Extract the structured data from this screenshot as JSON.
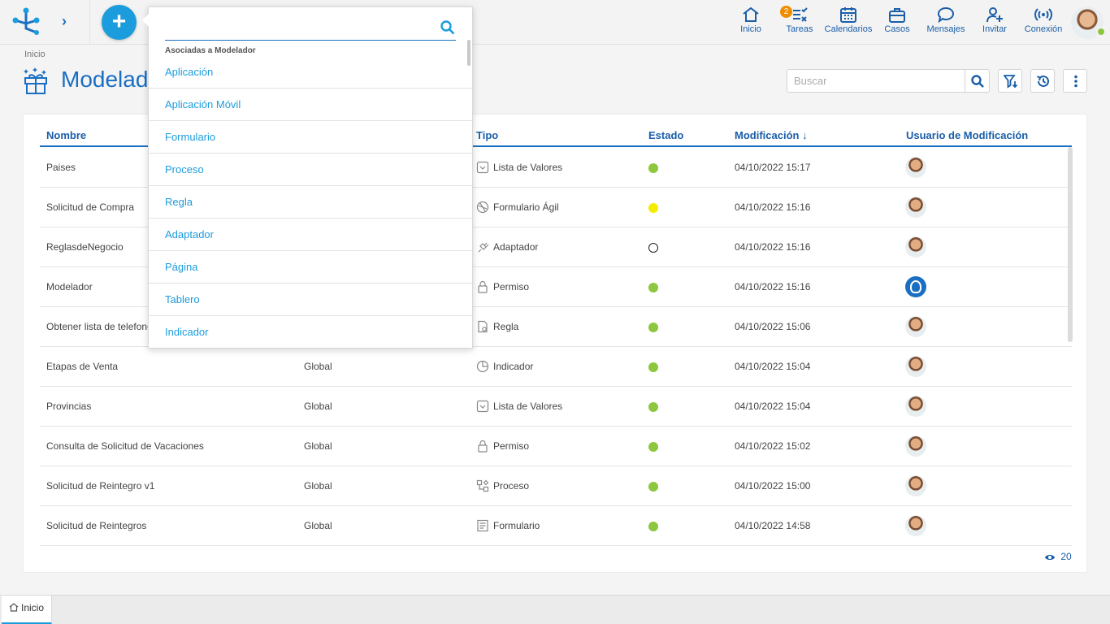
{
  "topbar": {
    "nav": [
      {
        "label": "Inicio",
        "icon": "home-icon"
      },
      {
        "label": "Tareas",
        "icon": "tasks-icon",
        "badge": "2"
      },
      {
        "label": "Calendarios",
        "icon": "calendar-icon"
      },
      {
        "label": "Casos",
        "icon": "briefcase-icon"
      },
      {
        "label": "Mensajes",
        "icon": "chat-icon"
      },
      {
        "label": "Invitar",
        "icon": "invite-user-icon"
      },
      {
        "label": "Conexión",
        "icon": "connection-icon"
      }
    ]
  },
  "breadcrumb": "Inicio",
  "page": {
    "title": "Modelador"
  },
  "search": {
    "placeholder": "Buscar"
  },
  "table": {
    "headers": {
      "nombre": "Nombre",
      "tipo": "Tipo",
      "estado": "Estado",
      "modificacion": "Modificación",
      "usuario": "Usuario de Modificación"
    },
    "rows": [
      {
        "nombre": "Paises",
        "ambito": "",
        "tipo": "Lista de Valores",
        "estado": "#8dc63f",
        "fecha": "04/10/2022 15:17",
        "usuario": "user-photo"
      },
      {
        "nombre": "Solicitud de Compra",
        "ambito": "",
        "tipo": "Formulario Ágil",
        "estado": "#f5ec00",
        "fecha": "04/10/2022 15:16",
        "usuario": "user-photo"
      },
      {
        "nombre": "ReglasdeNegocio",
        "ambito": "",
        "tipo": "Adaptador",
        "estado": "#ffffff",
        "fecha": "04/10/2022 15:16",
        "usuario": "user-photo"
      },
      {
        "nombre": "Modelador",
        "ambito": "",
        "tipo": "Permiso",
        "estado": "#8dc63f",
        "fecha": "04/10/2022 15:16",
        "usuario": "system-user"
      },
      {
        "nombre": "Obtener lista de telefonos",
        "ambito": "",
        "tipo": "Regla",
        "estado": "#8dc63f",
        "fecha": "04/10/2022 15:06",
        "usuario": "user-photo"
      },
      {
        "nombre": "Etapas de Venta",
        "ambito": "Global",
        "tipo": "Indicador",
        "estado": "#8dc63f",
        "fecha": "04/10/2022 15:04",
        "usuario": "user-photo"
      },
      {
        "nombre": "Provincias",
        "ambito": "Global",
        "tipo": "Lista de Valores",
        "estado": "#8dc63f",
        "fecha": "04/10/2022 15:04",
        "usuario": "user-photo"
      },
      {
        "nombre": "Consulta de Solicitud de Vacaciones",
        "ambito": "Global",
        "tipo": "Permiso",
        "estado": "#8dc63f",
        "fecha": "04/10/2022 15:02",
        "usuario": "user-photo"
      },
      {
        "nombre": "Solicitud de Reintegro v1",
        "ambito": "Global",
        "tipo": "Proceso",
        "estado": "#8dc63f",
        "fecha": "04/10/2022 15:00",
        "usuario": "user-photo"
      },
      {
        "nombre": "Solicitud de Reintegros",
        "ambito": "Global",
        "tipo": "Formulario",
        "estado": "#8dc63f",
        "fecha": "04/10/2022 14:58",
        "usuario": "user-photo"
      }
    ],
    "views_count": "20"
  },
  "dropdown": {
    "search_value": "",
    "section_label": "Asociadas a Modelador",
    "items": [
      "Aplicación",
      "Aplicación Móvil",
      "Formulario",
      "Proceso",
      "Regla",
      "Adaptador",
      "Página",
      "Tablero",
      "Indicador"
    ]
  },
  "bottom_tabs": [
    {
      "label": "Inicio",
      "icon": "home-icon"
    }
  ],
  "colors": {
    "primary": "#1a6fc2",
    "accent": "#1b9cdc",
    "ok": "#8dc63f",
    "warning": "#f5ec00",
    "badge": "#f08c00"
  }
}
